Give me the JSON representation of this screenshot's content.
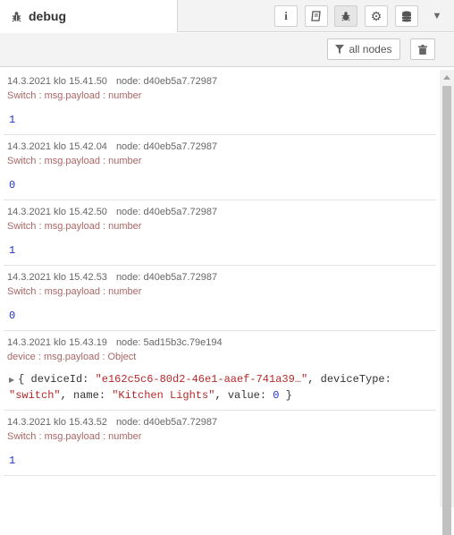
{
  "tab": {
    "title": "debug",
    "icon": "bug-icon"
  },
  "sidebar_buttons": [
    {
      "name": "info-icon",
      "glyph": "i"
    },
    {
      "name": "book-icon",
      "glyph": "📖"
    },
    {
      "name": "debug-icon",
      "glyph": "🐞"
    },
    {
      "name": "gear-icon",
      "glyph": "⚙"
    },
    {
      "name": "database-icon",
      "glyph": "🗄"
    }
  ],
  "toolbar": {
    "filter_label": "all nodes"
  },
  "messages": [
    {
      "time": "14.3.2021 klo 15.41.50",
      "node": "node: d40eb5a7.72987",
      "topic": "Switch : msg.payload : number",
      "value": "1"
    },
    {
      "time": "14.3.2021 klo 15.42.04",
      "node": "node: d40eb5a7.72987",
      "topic": "Switch : msg.payload : number",
      "value": "0"
    },
    {
      "time": "14.3.2021 klo 15.42.50",
      "node": "node: d40eb5a7.72987",
      "topic": "Switch : msg.payload : number",
      "value": "1"
    },
    {
      "time": "14.3.2021 klo 15.42.53",
      "node": "node: d40eb5a7.72987",
      "topic": "Switch : msg.payload : number",
      "value": "0"
    },
    {
      "time": "14.3.2021 klo 15.43.19",
      "node": "node: 5ad15b3c.79e194",
      "topic": "device : msg.payload : Object",
      "object": {
        "open": "{ deviceId: ",
        "deviceId": "\"e162c5c6-80d2-46e1-aaef-741a39…\"",
        "sep1": ", deviceType:",
        "deviceType": "\"switch\"",
        "sep2": ", name: ",
        "name": "\"Kitchen Lights\"",
        "sep3": ", value: ",
        "value": "0",
        "close": " }"
      }
    },
    {
      "time": "14.3.2021 klo 15.43.52",
      "node": "node: d40eb5a7.72987",
      "topic": "Switch : msg.payload : number",
      "value": "1"
    }
  ]
}
